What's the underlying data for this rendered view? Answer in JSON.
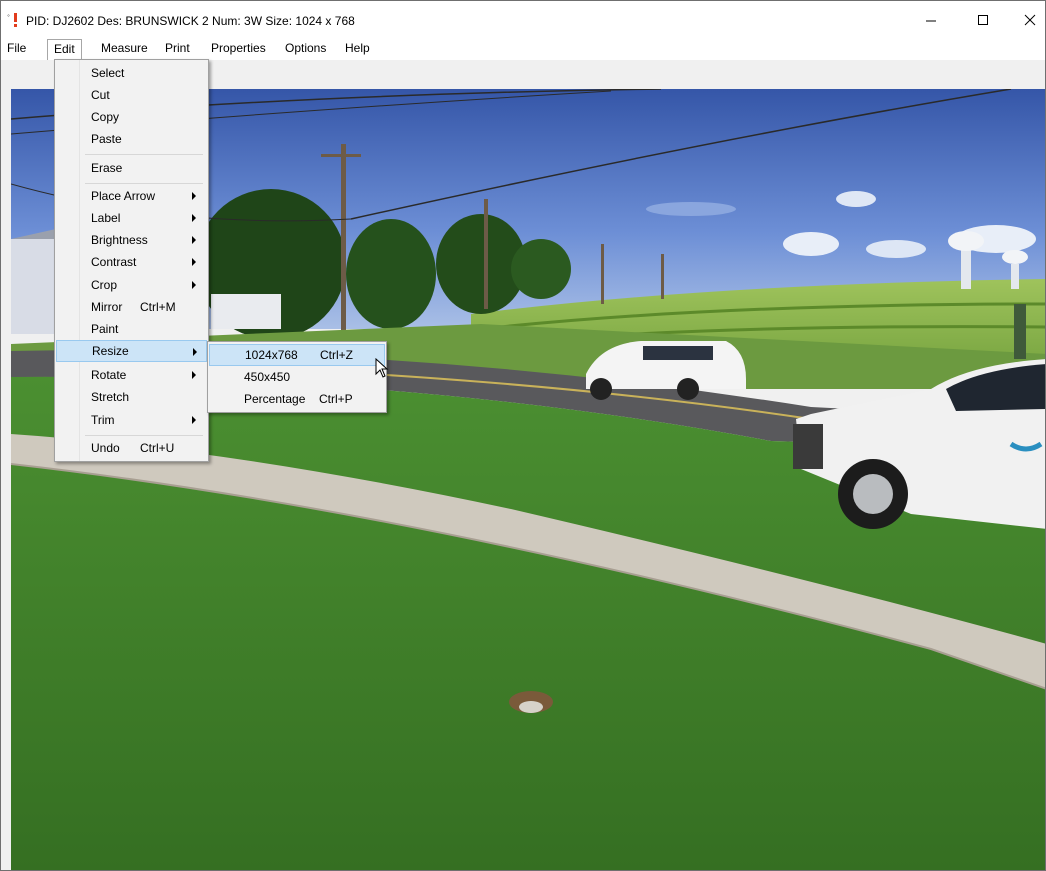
{
  "window": {
    "title": "PID: DJ2602  Des: BRUNSWICK 2  Num: 3W  Size: 1024 x 768",
    "controls": [
      "minimize",
      "maximize",
      "close"
    ]
  },
  "menubar": {
    "items": [
      "File",
      "Edit",
      "Measure",
      "Print",
      "Properties",
      "Options",
      "Help"
    ],
    "active": "Edit"
  },
  "edit_menu": {
    "items": [
      {
        "label": "Select"
      },
      {
        "label": "Cut"
      },
      {
        "label": "Copy"
      },
      {
        "label": "Paste"
      },
      {
        "label": "Erase"
      },
      {
        "label": "Place Arrow",
        "submenu": true
      },
      {
        "label": "Label",
        "submenu": true
      },
      {
        "label": "Brightness",
        "submenu": true
      },
      {
        "label": "Contrast",
        "submenu": true
      },
      {
        "label": "Crop",
        "submenu": true
      },
      {
        "label": "Mirror",
        "shortcut": "Ctrl+M"
      },
      {
        "label": "Paint"
      },
      {
        "label": "Resize",
        "submenu": true,
        "highlighted": true
      },
      {
        "label": "Rotate",
        "submenu": true
      },
      {
        "label": "Stretch"
      },
      {
        "label": "Trim",
        "submenu": true
      },
      {
        "label": "Undo",
        "shortcut": "Ctrl+U"
      }
    ]
  },
  "resize_submenu": {
    "items": [
      {
        "label": "1024x768",
        "shortcut": "Ctrl+Z",
        "highlighted": true
      },
      {
        "label": "450x450",
        "shortcut": ""
      },
      {
        "label": "Percentage",
        "shortcut": "Ctrl+P"
      }
    ]
  },
  "colors": {
    "menu_highlight": "#cce4f7",
    "menu_highlight_border": "#99c9ef",
    "sky": "#4f72c4",
    "grass": "#3f8a2a"
  }
}
